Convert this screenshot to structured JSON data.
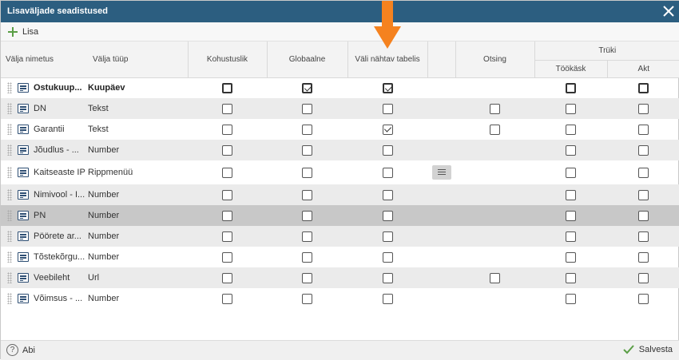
{
  "dialog": {
    "title": "Lisaväljade seadistused",
    "close_icon": "close-icon"
  },
  "toolbar": {
    "add_label": "Lisa",
    "add_icon": "plus-icon"
  },
  "columns": {
    "field_name": "Välja nimetus",
    "field_type": "Välja tüüp",
    "required": "Kohustuslik",
    "global": "Globaalne",
    "visible_in_table": "Väli nähtav tabelis",
    "extra": "",
    "search": "Otsing",
    "print_group": "Trüki",
    "print_workorder": "Töökäsk",
    "print_act": "Akt"
  },
  "rows": [
    {
      "name": "Ostukuup...",
      "type": "Kuupäev",
      "bold": true,
      "required": false,
      "global": true,
      "visible": true,
      "search": null,
      "listbtn": false,
      "print_workorder": false,
      "print_act": false,
      "dark": true
    },
    {
      "name": "DN",
      "type": "Tekst",
      "bold": false,
      "required": false,
      "global": false,
      "visible": false,
      "search": false,
      "listbtn": false,
      "print_workorder": false,
      "print_act": false
    },
    {
      "name": "Garantii",
      "type": "Tekst",
      "bold": false,
      "required": false,
      "global": false,
      "visible": true,
      "search": false,
      "listbtn": false,
      "print_workorder": false,
      "print_act": false
    },
    {
      "name": "Jõudlus - ...",
      "type": "Number",
      "bold": false,
      "required": false,
      "global": false,
      "visible": false,
      "search": null,
      "listbtn": false,
      "print_workorder": false,
      "print_act": false
    },
    {
      "name": "Kaitseaste IP",
      "type": "Rippmenüü",
      "bold": false,
      "required": false,
      "global": false,
      "visible": false,
      "search": null,
      "listbtn": true,
      "print_workorder": false,
      "print_act": false,
      "tall": true
    },
    {
      "name": "Nimivool - I...",
      "type": "Number",
      "bold": false,
      "required": false,
      "global": false,
      "visible": false,
      "search": null,
      "listbtn": false,
      "print_workorder": false,
      "print_act": false
    },
    {
      "name": "PN",
      "type": "Number",
      "bold": false,
      "required": false,
      "global": false,
      "visible": false,
      "search": null,
      "listbtn": false,
      "print_workorder": false,
      "print_act": false,
      "selected": true
    },
    {
      "name": "Pöörete ar...",
      "type": "Number",
      "bold": false,
      "required": false,
      "global": false,
      "visible": false,
      "search": null,
      "listbtn": false,
      "print_workorder": false,
      "print_act": false
    },
    {
      "name": "Tõstekõrgu...",
      "type": "Number",
      "bold": false,
      "required": false,
      "global": false,
      "visible": false,
      "search": null,
      "listbtn": false,
      "print_workorder": false,
      "print_act": false
    },
    {
      "name": "Veebileht",
      "type": "Url",
      "bold": false,
      "required": false,
      "global": false,
      "visible": false,
      "search": false,
      "listbtn": false,
      "print_workorder": false,
      "print_act": false
    },
    {
      "name": "Võimsus - ...",
      "type": "Number",
      "bold": false,
      "required": false,
      "global": false,
      "visible": false,
      "search": null,
      "listbtn": false,
      "print_workorder": false,
      "print_act": false
    }
  ],
  "footer": {
    "help_label": "Abi",
    "help_icon": "question-circle-icon",
    "save_label": "Salvesta",
    "save_icon": "checkmark-icon"
  },
  "colors": {
    "titlebar": "#2c5e80",
    "arrow": "#f5821f",
    "add_icon": "#5a9e45",
    "save_icon": "#5a9e45"
  }
}
